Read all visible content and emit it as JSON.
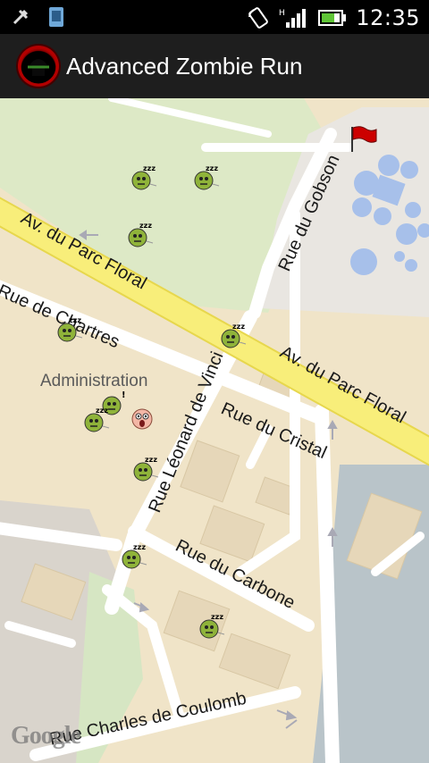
{
  "status_bar": {
    "time": "12:35",
    "left_icons": [
      "usb-icon",
      "sd-card-icon"
    ],
    "right_icons": [
      "rotation-icon",
      "signal-hplus-icon",
      "battery-icon"
    ],
    "network_label": "H"
  },
  "app": {
    "title": "Advanced Zombie Run",
    "icon": "zombie-app-icon"
  },
  "map": {
    "streets": [
      "Av. du Parc Floral",
      "Av. du Parc Floral",
      "Rue du Gobson",
      "Rue de Chartres",
      "Rue Léonard de Vinci",
      "Rue du Cristal",
      "Rue du Carbone",
      "Rue Charles de Coulomb"
    ],
    "poi_label": "Administration",
    "attribution": "Google",
    "zombies": [
      {
        "state": "sleeping",
        "label": "zzz"
      },
      {
        "state": "sleeping",
        "label": "zzz"
      },
      {
        "state": "sleeping",
        "label": "zzz"
      },
      {
        "state": "sleeping",
        "label": "zzz"
      },
      {
        "state": "sleeping",
        "label": "zzz"
      },
      {
        "state": "alert",
        "label": "!"
      },
      {
        "state": "sleeping",
        "label": "zzz"
      },
      {
        "state": "sleeping",
        "label": "zzz"
      },
      {
        "state": "sleeping",
        "label": "zzz"
      },
      {
        "state": "sleeping",
        "label": "zzz"
      }
    ],
    "player": {
      "state": "scared"
    },
    "goal": {
      "type": "flag",
      "color": "#cc0000"
    }
  },
  "colors": {
    "major_road": "#f8ee7a",
    "road": "#ffffff",
    "park": "#dde9c6",
    "water": "#a7c0ea",
    "land": "#f0e4c8",
    "zombie_skin": "#8fb33a"
  }
}
